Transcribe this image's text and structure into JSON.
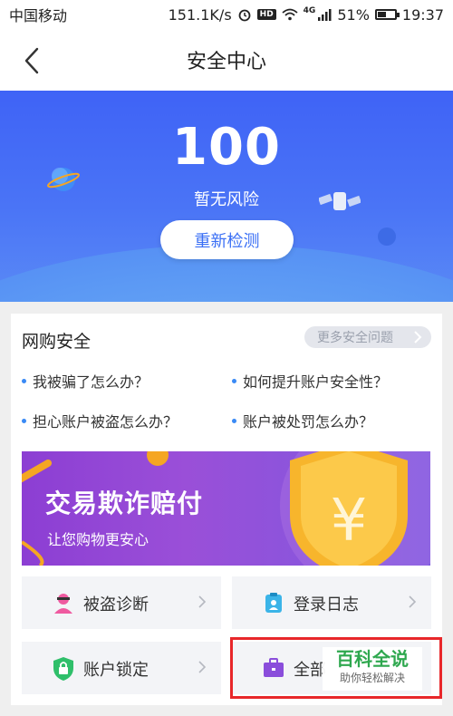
{
  "status": {
    "carrier": "中国移动",
    "speed": "151.1K/s",
    "hd": "HD",
    "net": "4G",
    "battery": "51%",
    "battery_level": 0.51,
    "time": "19:37"
  },
  "nav": {
    "title": "安全中心"
  },
  "hero": {
    "score": "100",
    "risk": "暂无风险",
    "recheck": "重新检测"
  },
  "card": {
    "title": "网购安全",
    "more": "更多安全问题",
    "questions": [
      "我被骗了怎么办？",
      "如何提升账户安全性？",
      "担心账户被盗怎么办？",
      "账户被处罚怎么办？"
    ],
    "banner": {
      "title": "交易欺诈赔付",
      "subtitle": "让您购物更安心"
    },
    "tiles": [
      {
        "label": "被盗诊断",
        "icon": "thief-icon"
      },
      {
        "label": "登录日志",
        "icon": "log-icon"
      },
      {
        "label": "账户锁定",
        "icon": "shield-lock-icon"
      },
      {
        "label": "全部",
        "icon": "briefcase-icon"
      }
    ]
  },
  "watermark": {
    "title": "百科全说",
    "subtitle": "助你轻松解决"
  },
  "colors": {
    "accent": "#3a6ff5",
    "highlight": "#e8272a",
    "watermark": "#2fa84f"
  }
}
